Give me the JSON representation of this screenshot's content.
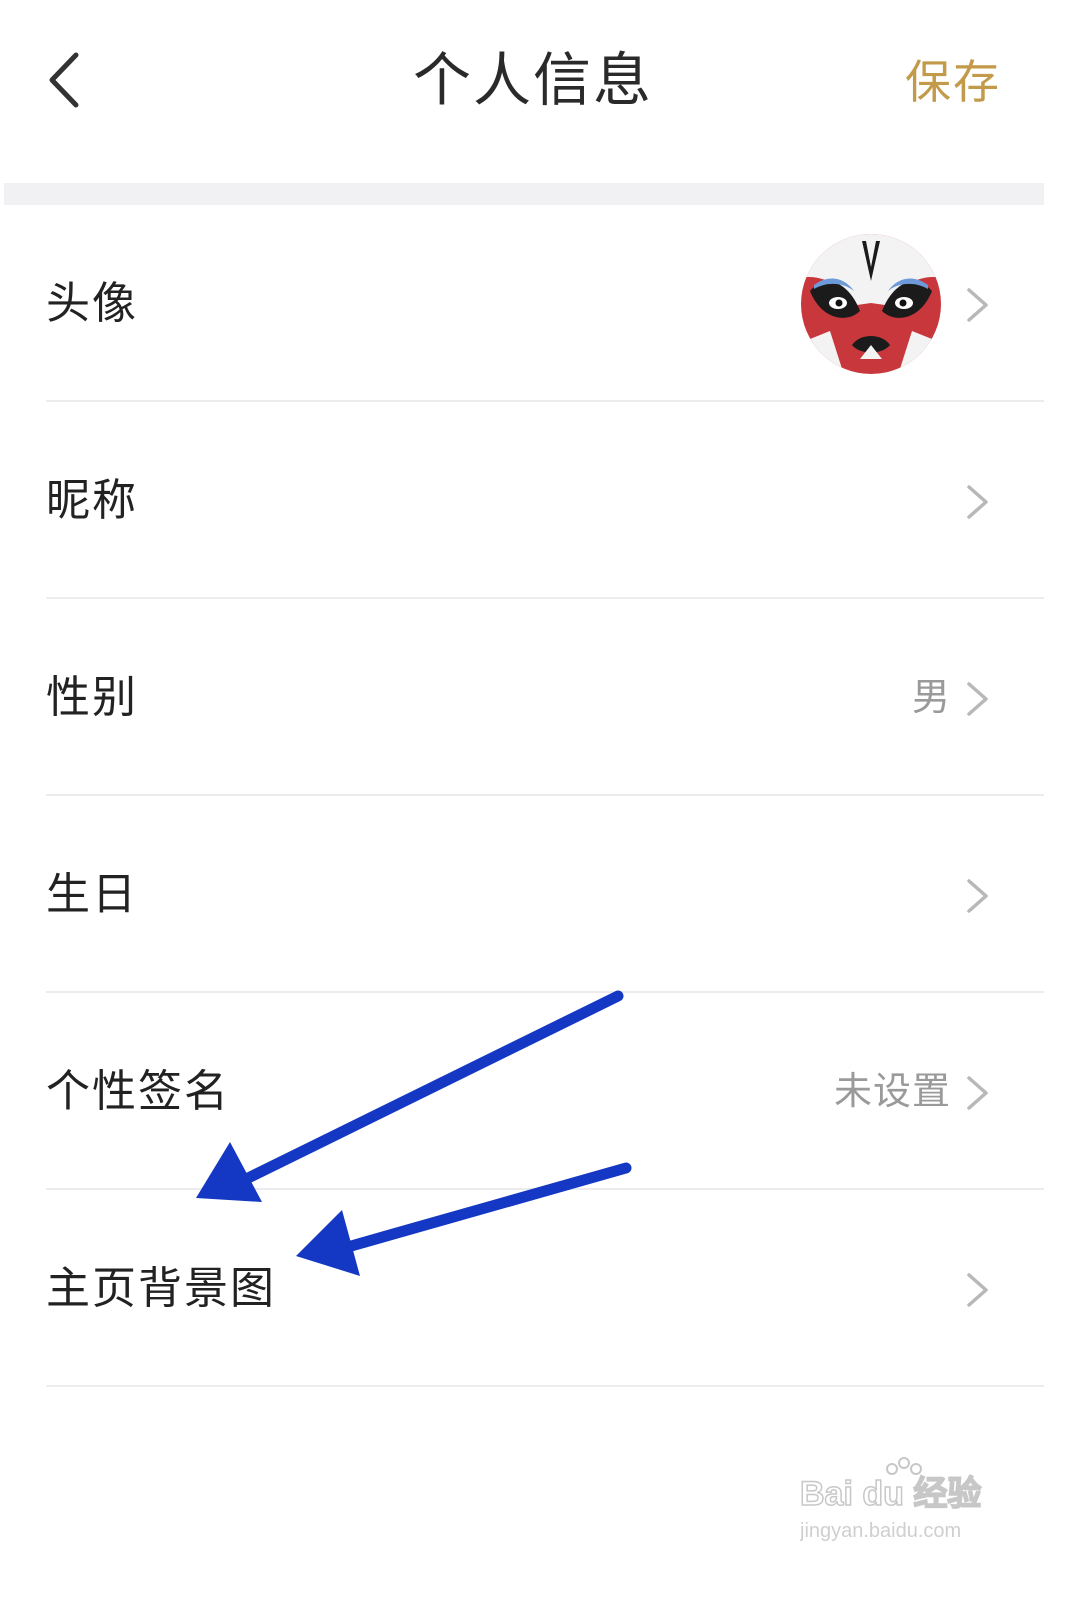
{
  "header": {
    "title": "个人信息",
    "save_label": "保存",
    "back_icon": "chevron-left-icon"
  },
  "colors": {
    "accent": "#c39a4a",
    "annotation_arrow": "#1538c4",
    "chevron": "#b8b8b8"
  },
  "rows": [
    {
      "label": "头像",
      "value": ""
    },
    {
      "label": "昵称",
      "value": ""
    },
    {
      "label": "性别",
      "value": "男"
    },
    {
      "label": "生日",
      "value": ""
    },
    {
      "label": "个性签名",
      "value": "未设置"
    },
    {
      "label": "主页背景图",
      "value": ""
    }
  ],
  "watermark": {
    "brand": "Bai du 经验",
    "url": "jingyan.baidu.com"
  }
}
